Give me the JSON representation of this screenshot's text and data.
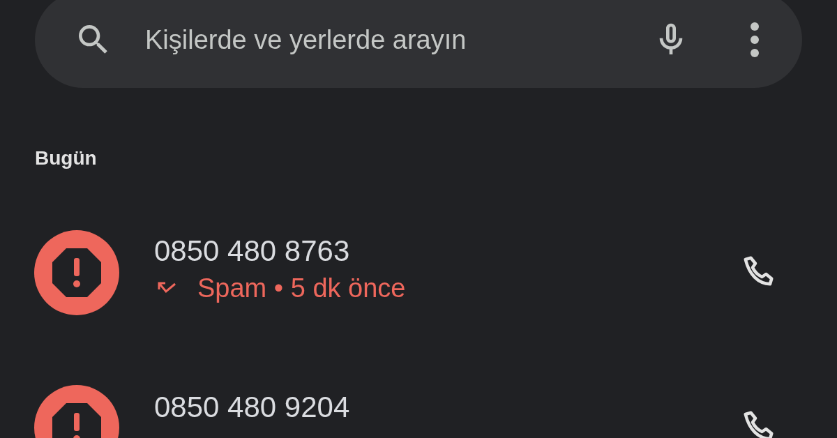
{
  "search": {
    "placeholder": "Kişilerde ve yerlerde arayın"
  },
  "section_header": "Bugün",
  "calls": [
    {
      "number": "0850 480 8763",
      "spam": true,
      "kind": "missed",
      "detail": "Spam • 5 dk önce"
    },
    {
      "number": "0850 480 9204",
      "spam": true
    }
  ]
}
